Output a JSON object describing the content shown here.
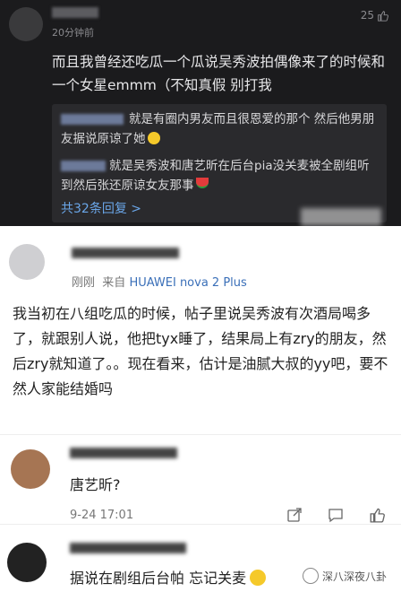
{
  "panel1": {
    "time": "20分钟前",
    "likes": "25",
    "body": "而且我曾经还吃瓜一个瓜说吴秀波拍偶像来了的时候和一个女星emmm（不知真假 别打我",
    "reply1": "就是有圈内男友而且很恩爱的那个 然后他男朋友据说原谅了她",
    "reply2": "就是吴秀波和唐艺昕在后台pia没关麦被全剧组听到然后张还原谅女友那事",
    "more": "共32条回复 >"
  },
  "panel2": {
    "time": "刚刚",
    "source_prefix": "来自",
    "device": "HUAWEI nova 2 Plus",
    "body": "我当初在八组吃瓜的时候，帖子里说吴秀波有次酒局喝多了，就跟别人说，他把tyx睡了，结果局上有zry的朋友，然后zry就知道了。。现在看来，估计是油腻大叔的yy吧，要不然人家能结婚吗"
  },
  "panel3": {
    "body": "唐艺昕?",
    "date": "9-24 17:01"
  },
  "panel4": {
    "body": "据说在剧组后台帕 忘记关麦",
    "watermark": "深八深夜八卦"
  }
}
